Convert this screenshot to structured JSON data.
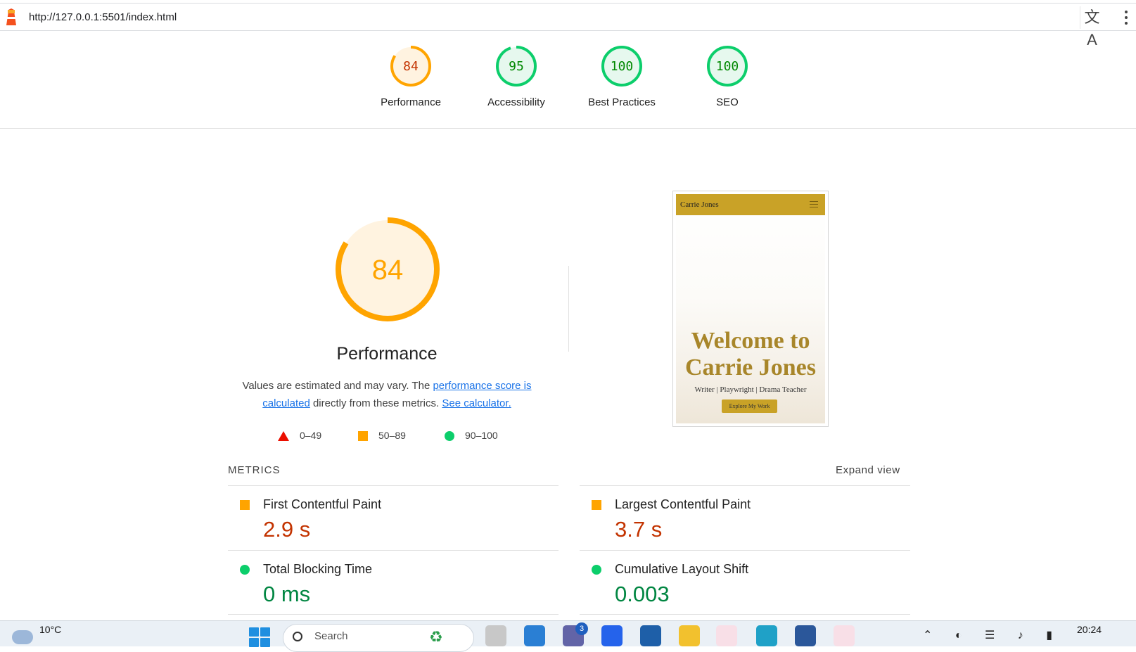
{
  "browser": {
    "url": "http://127.0.0.1:5501/index.html",
    "translate_icon": "translate-icon",
    "menu_icon": "kebab-menu-icon"
  },
  "scores": [
    {
      "label": "Performance",
      "value": "84",
      "color": "#ffa400",
      "text_color": "#c33300",
      "fill": "#fff3e0",
      "fraction": 0.84
    },
    {
      "label": "Accessibility",
      "value": "95",
      "color": "#0cce6b",
      "text_color": "#008800",
      "fill": "#e6f8ee",
      "fraction": 0.95
    },
    {
      "label": "Best Practices",
      "value": "100",
      "color": "#0cce6b",
      "text_color": "#008800",
      "fill": "#e6f8ee",
      "fraction": 1.0
    },
    {
      "label": "SEO",
      "value": "100",
      "color": "#0cce6b",
      "text_color": "#008800",
      "fill": "#e6f8ee",
      "fraction": 1.0
    }
  ],
  "performance": {
    "score": "84",
    "fraction": 0.84,
    "color": "#ffa400",
    "title": "Performance",
    "desc_prefix": "Values are estimated and may vary. The ",
    "desc_link1": "performance score is calculated",
    "desc_middle": " directly from these metrics. ",
    "desc_link2": "See calculator.",
    "legend": [
      {
        "shape": "triangle",
        "range": "0–49",
        "color": "#eb0f00"
      },
      {
        "shape": "square",
        "range": "50–89",
        "color": "#ffa400"
      },
      {
        "shape": "circle",
        "range": "90–100",
        "color": "#0cce6b"
      }
    ]
  },
  "thumbnail": {
    "brand": "Carrie Jones",
    "heading_line1": "Welcome to",
    "heading_line2": "Carrie Jones",
    "subtitle": "Writer | Playwright | Drama Teacher",
    "button": "Explore My Work"
  },
  "metrics": {
    "header": "METRICS",
    "expand": "Expand view",
    "left": [
      {
        "name": "First Contentful Paint",
        "value": "2.9 s",
        "status": "average"
      },
      {
        "name": "Total Blocking Time",
        "value": "0 ms",
        "status": "pass"
      }
    ],
    "right": [
      {
        "name": "Largest Contentful Paint",
        "value": "3.7 s",
        "status": "average"
      },
      {
        "name": "Cumulative Layout Shift",
        "value": "0.003",
        "status": "pass"
      }
    ]
  },
  "taskbar": {
    "temperature": "10°C",
    "search_placeholder": "Search",
    "teams_badge": "3",
    "time": "20:24"
  }
}
